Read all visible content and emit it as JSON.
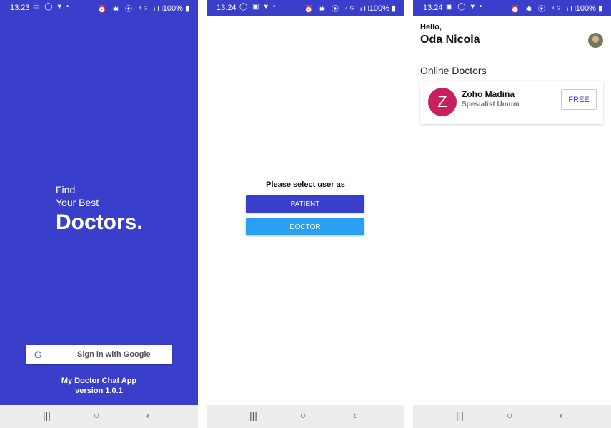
{
  "screen1": {
    "status": {
      "time": "13:23",
      "left_icons": "▭ ◯ ♥ •",
      "right_icons": "⏰ ✱ ⦿ ⁴ᴳ ıll",
      "battery": "100% ▮"
    },
    "tagline_line1": "Find",
    "tagline_line2": "Your Best",
    "headline": "Doctors.",
    "google_button": {
      "label": "Sign in with Google",
      "logo": "G"
    },
    "app_name": "My Doctor Chat App",
    "version": "version 1.0.1",
    "nav": {
      "recent": "|||",
      "home": "○",
      "back": "‹"
    }
  },
  "screen2": {
    "status": {
      "time": "13:24",
      "left_icons": "◯ ▣ ♥ •",
      "right_icons": "⏰ ✱ ⦿ ⁴ᴳ ıll",
      "battery": "100% ▮"
    },
    "prompt": "Please select user as",
    "patient_label": "PATIENT",
    "doctor_label": "DOCTOR",
    "nav": {
      "recent": "|||",
      "home": "○",
      "back": "‹"
    }
  },
  "screen3": {
    "status": {
      "time": "13:24",
      "left_icons": "▣ ◯ ♥ •",
      "right_icons": "⏰ ✱ ⦿ ⁴ᴳ ıll",
      "battery": "100% ▮"
    },
    "greeting": "Hello,",
    "user_name": "Oda Nicola",
    "section_title": "Online Doctors",
    "doctor": {
      "initial": "Z",
      "name": "Zoho Madina",
      "specialty": "Spesialist Umum",
      "price_label": "FREE"
    },
    "nav": {
      "recent": "|||",
      "home": "○",
      "back": "‹"
    }
  },
  "colors": {
    "primary": "#3a3fcb",
    "accent": "#29a0f2",
    "avatar_bg": "#c81f5f",
    "nav_bg": "#ededed"
  }
}
